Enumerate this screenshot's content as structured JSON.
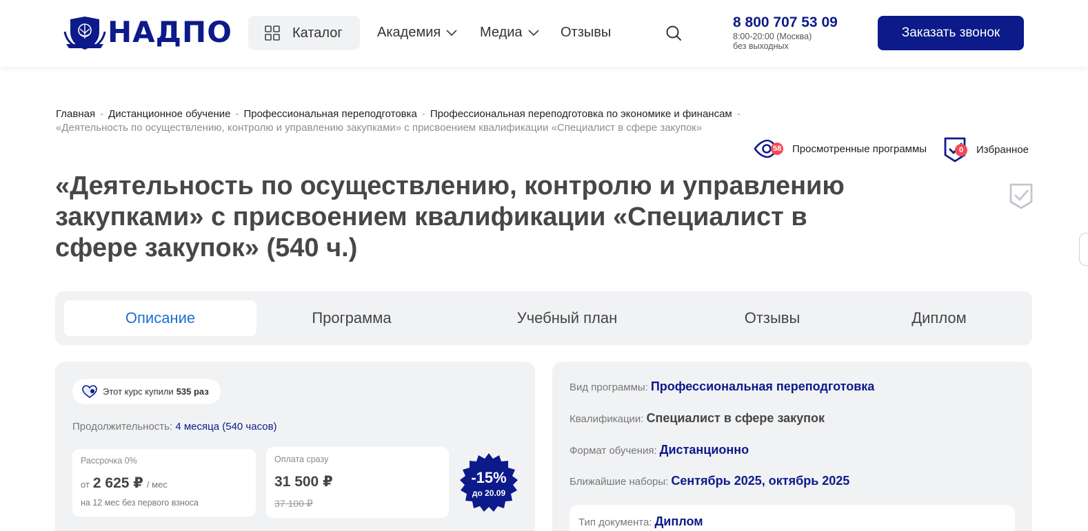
{
  "header": {
    "logo_text": "НАДПО",
    "catalog_label": "Каталог",
    "nav": [
      {
        "label": "Академия",
        "has_dropdown": true
      },
      {
        "label": "Медиа",
        "has_dropdown": true
      },
      {
        "label": "Отзывы",
        "has_dropdown": false
      }
    ],
    "phone": "8 800 707 53 09",
    "hours": "8:00-20:00 (Москва)",
    "days": "без выходных",
    "callback_label": "Заказать звонок"
  },
  "breadcrumb": {
    "items": [
      "Главная",
      "Дистанционное обучение",
      "Профессиональная переподготовка",
      "Профессиональная переподготовка по экономике и финансам"
    ],
    "separator": "-",
    "current": "«Деятельность по осуществлению, контролю и управлению закупками» с присвоением квалификации «Специалист в сфере закупок»"
  },
  "user_actions": {
    "viewed_label": "Просмотренные программы",
    "viewed_count": "58",
    "favorites_label": "Избранное",
    "favorites_count": "0"
  },
  "page_title": "«Деятельность по осуществлению, контролю и управлению закупками» с присвоением квалификации «Специалист в сфере закупок» (540 ч.)",
  "tabs": [
    {
      "label": "Описание",
      "active": true
    },
    {
      "label": "Программа",
      "active": false
    },
    {
      "label": "Учебный план",
      "active": false
    },
    {
      "label": "Отзывы",
      "active": false
    },
    {
      "label": "Диплом",
      "active": false
    }
  ],
  "course_card": {
    "bought_prefix": "Этот курс купили",
    "bought_count": "535 раз",
    "duration_label": "Продолжительность:",
    "duration_value": "4 месяца (540 часов)",
    "installment": {
      "label": "Рассрочка 0%",
      "prefix": "от",
      "amount": "2 625 ₽",
      "suffix": "/ мес",
      "note": "на 12 мес без первого взноса"
    },
    "full_payment": {
      "label": "Оплата сразу",
      "price": "31 500 ₽",
      "old_price": "37 100 ₽"
    },
    "discount": {
      "percent": "-15%",
      "until": "до 20.09"
    }
  },
  "program_info": {
    "rows": [
      {
        "label": "Вид программы:",
        "value": "Профессиональная переподготовка"
      },
      {
        "label": "Квалификации:",
        "value": "Специалист в сфере закупок"
      },
      {
        "label": "Формат обучения:",
        "value": "Дистанционно"
      },
      {
        "label": "Ближайшие наборы:",
        "value": "Сентябрь 2025, октябрь 2025"
      }
    ],
    "document": {
      "label": "Тип документа:",
      "value": "Диплом"
    }
  },
  "colors": {
    "brand_navy": "#0c1a8a",
    "active_tab": "#1b6fd1",
    "badge_red": "#f24a55",
    "panel_gray": "#f1f2f4"
  },
  "icons": [
    "emblem-logo",
    "grid-icon",
    "chevron-down-icon",
    "search-icon",
    "eye-icon",
    "shield-check-icon",
    "bookmark-check-icon",
    "heart-badge-icon",
    "discount-star-badge"
  ]
}
